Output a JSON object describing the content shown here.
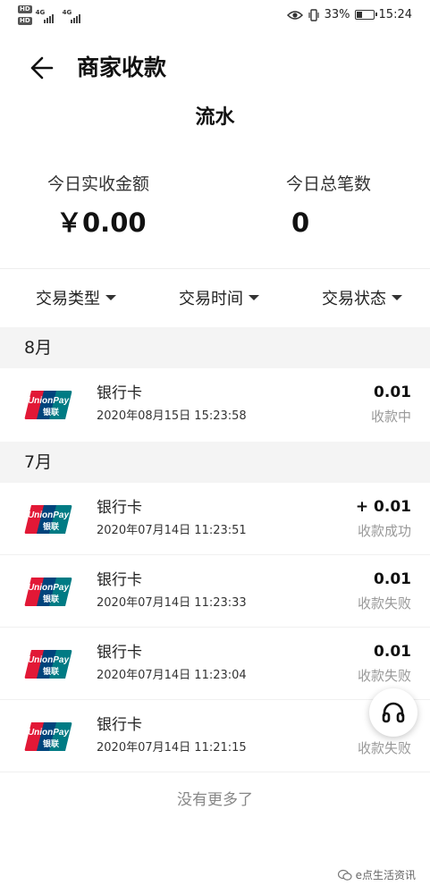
{
  "status_bar": {
    "hd": [
      "HD",
      "HD"
    ],
    "network_1": "4G",
    "network_2": "4G",
    "battery_percent": "33%",
    "battery_level": 0.33,
    "time": "15:24"
  },
  "header": {
    "title": "商家收款"
  },
  "subtitle": "流水",
  "summary": {
    "income_label": "今日实收金额",
    "income_value": "￥0.00",
    "count_label": "今日总笔数",
    "count_value": "0"
  },
  "filters": [
    "交易类型",
    "交易时间",
    "交易状态"
  ],
  "groups": [
    {
      "month": "8月",
      "items": [
        {
          "name": "银行卡",
          "time": "2020年08月15日 15:23:58",
          "amount": "0.01",
          "status": "收款中"
        }
      ]
    },
    {
      "month": "7月",
      "items": [
        {
          "name": "银行卡",
          "time": "2020年07月14日 11:23:51",
          "amount": "+ 0.01",
          "status": "收款成功"
        },
        {
          "name": "银行卡",
          "time": "2020年07月14日 11:23:33",
          "amount": "0.01",
          "status": "收款失败"
        },
        {
          "name": "银行卡",
          "time": "2020年07月14日 11:23:04",
          "amount": "0.01",
          "status": "收款失败"
        },
        {
          "name": "银行卡",
          "time": "2020年07月14日 11:21:15",
          "amount": "",
          "status": "收款失败"
        }
      ]
    }
  ],
  "card_logo": {
    "brand_text": "UnionPay",
    "cn_text": "银联",
    "icon": "unionpay-logo",
    "colors": [
      "#e21836",
      "#00447c",
      "#007b84"
    ]
  },
  "no_more": "没有更多了",
  "fab_icon": "headset-icon",
  "watermark": "e点生活资讯"
}
